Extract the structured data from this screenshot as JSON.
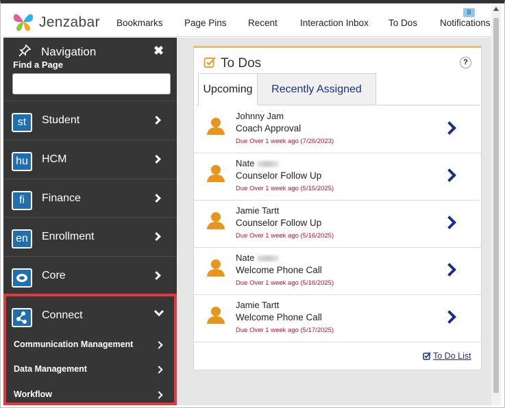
{
  "topnav": {
    "brand": "Jenzabar",
    "links": [
      "Bookmarks",
      "Page Pins",
      "Recent",
      "Interaction Inbox",
      "To Dos",
      "Notifications"
    ],
    "notification_count": "8"
  },
  "sidebar": {
    "title": "Navigation",
    "close_symbol": "✖",
    "find_label": "Find a Page",
    "find_placeholder": "",
    "items": [
      {
        "abbr": "st",
        "label": "Student",
        "icon": "student-icon"
      },
      {
        "abbr": "hu",
        "label": "HCM",
        "icon": "hcm-icon"
      },
      {
        "abbr": "fi",
        "label": "Finance",
        "icon": "finance-icon"
      },
      {
        "abbr": "en",
        "label": "Enrollment",
        "icon": "enrollment-icon"
      },
      {
        "abbr": "",
        "label": "Core",
        "icon": "core-icon"
      },
      {
        "abbr": "",
        "label": "Connect",
        "icon": "connect-icon"
      }
    ],
    "connect_sub": [
      "Communication Management",
      "Data Management",
      "Workflow"
    ]
  },
  "todos": {
    "title": "To Dos",
    "help": "?",
    "tabs": [
      "Upcoming",
      "Recently Assigned"
    ],
    "items": [
      {
        "name": "Johnny Jam",
        "task": "Coach Approval",
        "due": "Due Over 1 week ago (7/26/2023)",
        "redacted": false
      },
      {
        "name": "Nate",
        "task": "Counselor Follow Up",
        "due": "Due Over 1 week ago (5/15/2025)",
        "redacted": true
      },
      {
        "name": "Jamie Tartt",
        "task": "Counselor Follow Up",
        "due": "Due Over 1 week ago (5/16/2025)",
        "redacted": false
      },
      {
        "name": "Nate",
        "task": "Welcome Phone Call",
        "due": "Due Over 1 week ago (5/16/2025)",
        "redacted": true
      },
      {
        "name": "Jamie Tartt",
        "task": "Welcome Phone Call",
        "due": "Due Over 1 week ago (5/17/2025)",
        "redacted": false
      }
    ],
    "list_link": "To Do List"
  },
  "colors": {
    "sidebar_bg": "#363636",
    "highlight": "#e5383b",
    "link": "#1a2d8a",
    "due": "#c8102e",
    "avatar": "#e8951d",
    "card_accent": "#e6c275"
  }
}
